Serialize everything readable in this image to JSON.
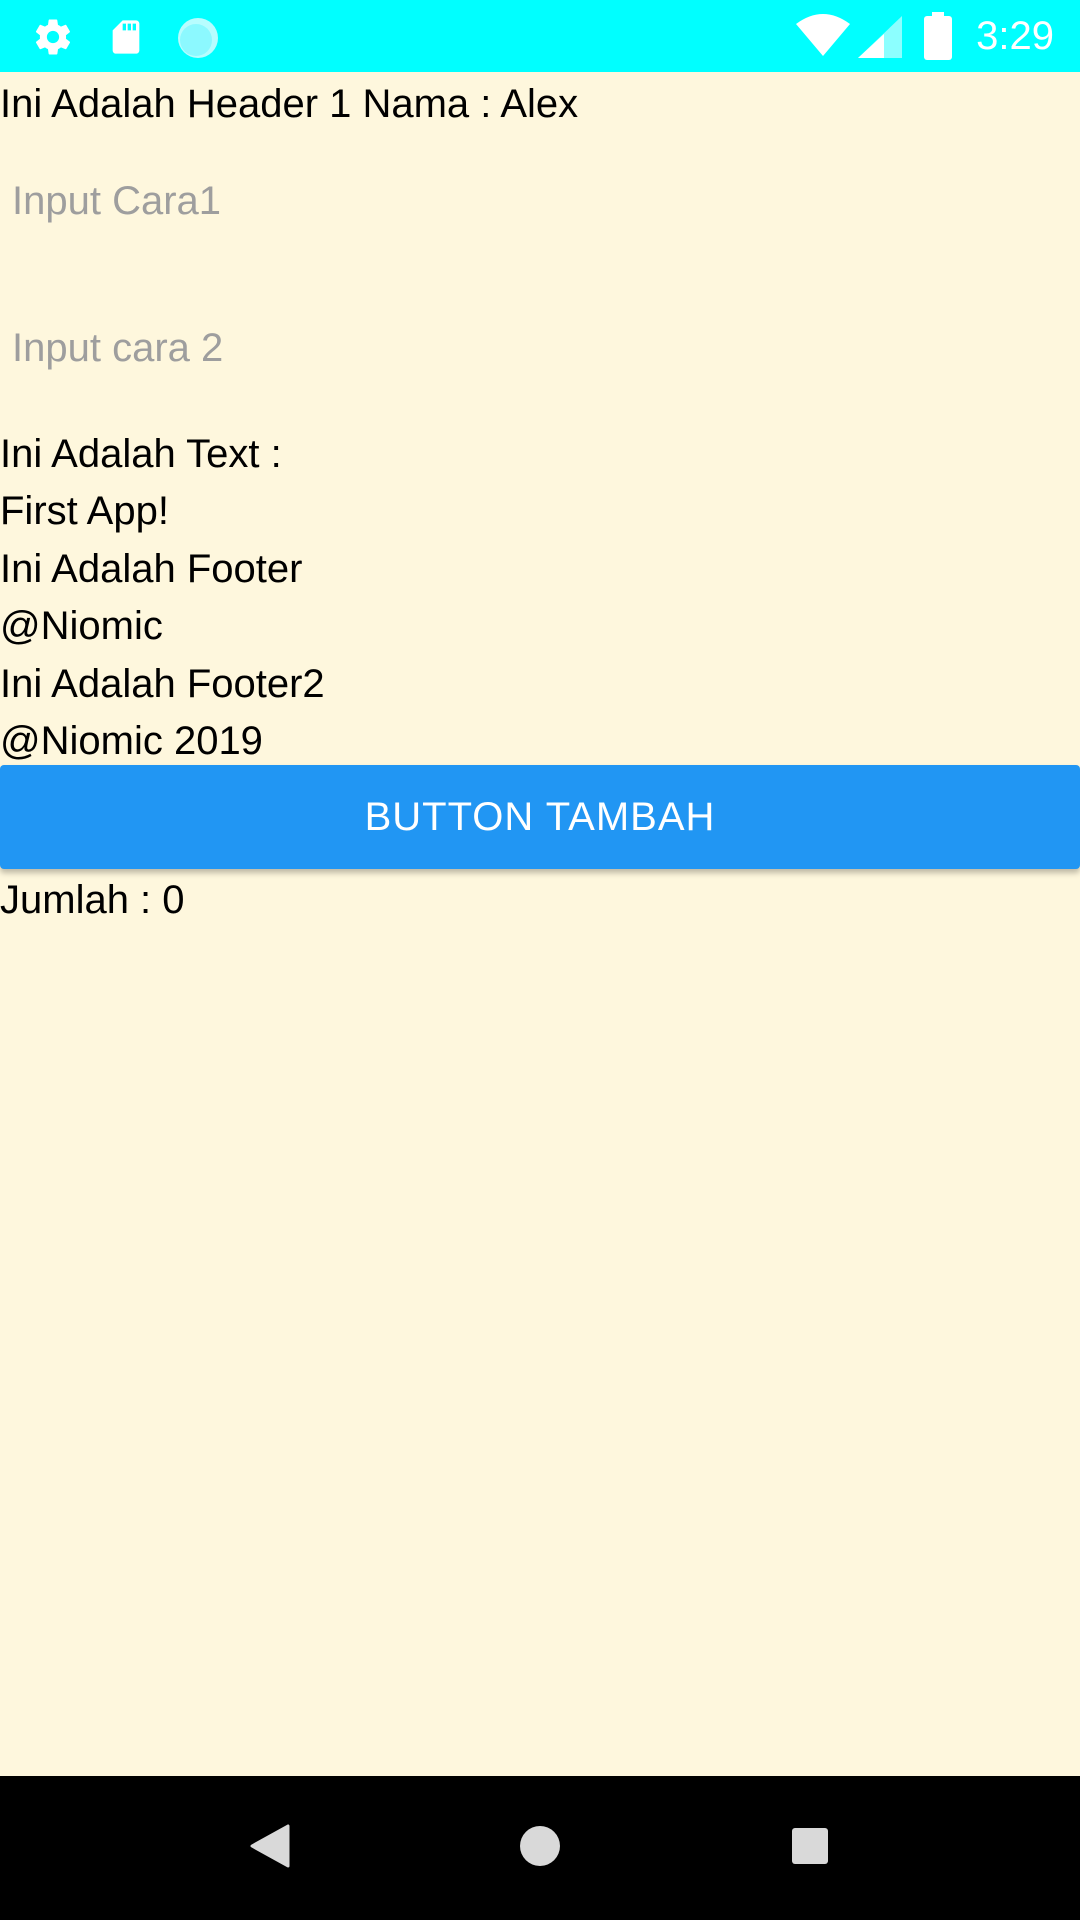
{
  "status_bar": {
    "time": "3:29",
    "left_icons": [
      "settings-icon",
      "sd-card-icon",
      "circle-notification-icon"
    ],
    "right_icons": [
      "wifi-icon",
      "cellular-signal-icon",
      "battery-icon"
    ],
    "background_color": "#00ffff"
  },
  "main": {
    "header_text": "Ini Adalah Header 1 Nama : Alex",
    "input1_placeholder": "Input Cara1",
    "input2_placeholder": "Input cara 2",
    "text_label": "Ini Adalah Text :",
    "text_value": "First App!",
    "footer1_label": "Ini Adalah Footer",
    "footer1_value": "@Niomic",
    "footer2_label": "Ini Adalah Footer2",
    "footer2_value": "@Niomic 2019",
    "button_label": "BUTTON TAMBAH",
    "count_text": "Jumlah : 0",
    "background_color": "#fef7dd",
    "button_color": "#2196f3"
  },
  "nav_bar": {
    "buttons": [
      "back-icon",
      "home-icon",
      "recents-icon"
    ]
  }
}
